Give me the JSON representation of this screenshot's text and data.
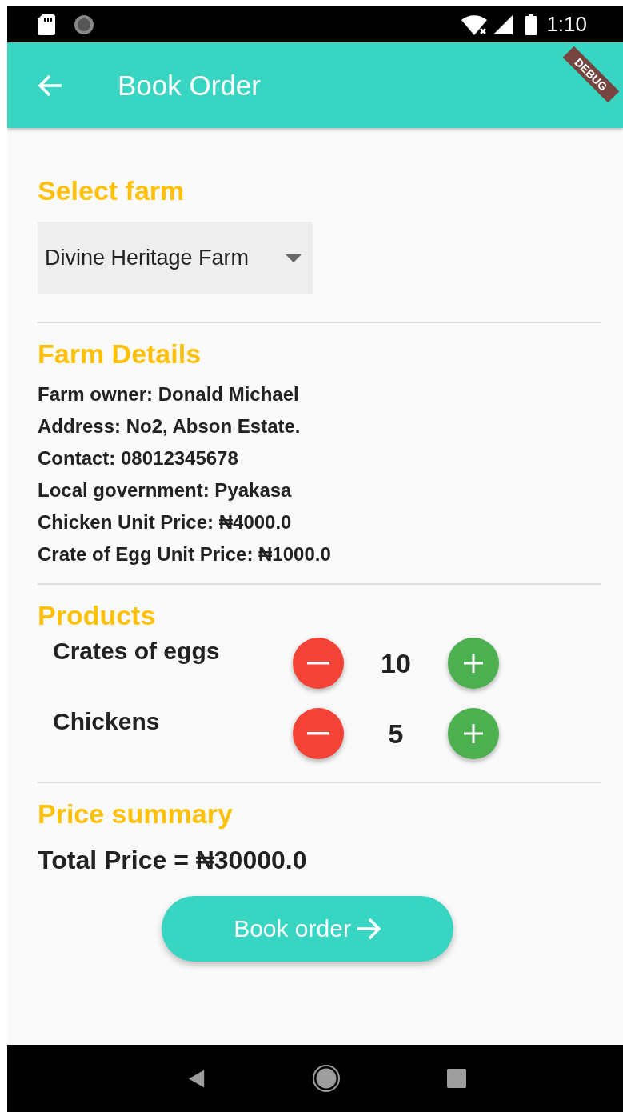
{
  "status_bar": {
    "time": "1:10"
  },
  "debug_banner": "DEBUG",
  "app_bar": {
    "title": "Book Order"
  },
  "select_farm": {
    "heading": "Select farm",
    "dropdown": {
      "value": "Divine Heritage Farm"
    }
  },
  "farm_details": {
    "heading": "Farm Details",
    "lines": [
      "Farm owner: Donald Michael",
      "Address: No2, Abson Estate.",
      "Contact: 08012345678",
      "Local government: Pyakasa",
      "Chicken Unit Price: ₦4000.0",
      "Crate of Egg Unit Price: ₦1000.0"
    ]
  },
  "products": {
    "heading": "Products",
    "items": [
      {
        "name": "Crates of eggs",
        "count": "10"
      },
      {
        "name": "Chickens",
        "count": "5"
      }
    ]
  },
  "price_summary": {
    "heading": "Price summary",
    "total": "Total Price = ₦30000.0"
  },
  "book_button": {
    "label": "Book order"
  }
}
